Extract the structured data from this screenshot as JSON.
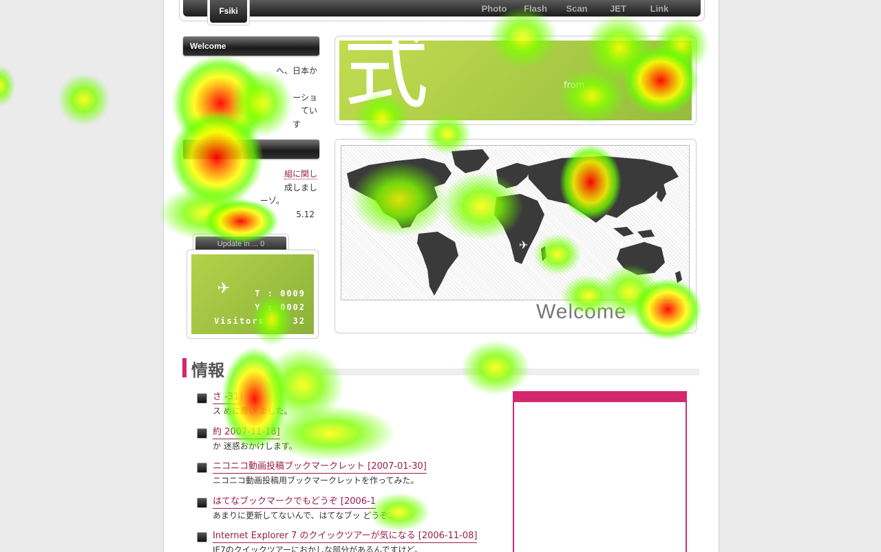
{
  "nav": {
    "brand": "Fsiki",
    "links": [
      "Photo",
      "Flash",
      "Scan",
      "JET",
      "Link"
    ]
  },
  "sidebar": {
    "welcome_title": "Welcome",
    "welcome_lines": [
      "へ、日本か",
      "ーショ",
      "てい",
      "す"
    ],
    "news_lines": [
      "組に関し",
      "成しまし",
      "ーゾ。",
      "5.12"
    ],
    "update_label": "Update in ... 0",
    "visitor_counts": [
      "T : 0009",
      "Y : 0002"
    ],
    "visitors_label": "Visitors",
    "visitors_value": "32"
  },
  "hero": {
    "kanji": "式",
    "from_text": "from"
  },
  "map": {
    "welcome": "Welcome"
  },
  "info": {
    "title": "情報",
    "items": [
      {
        "title": "さ -31]",
        "desc": "ス めに舞い ました。"
      },
      {
        "title": "約 2007-11-18]",
        "desc": "か 迷惑おかけします。"
      },
      {
        "title": "ニコニコ動画投稿ブックマークレット [2007-01-30]",
        "desc": "ニコニコ動画投稿用ブックマークレットを作ってみた。"
      },
      {
        "title": "はてなブックマークでもどうぞ [2006-1",
        "desc": "あまりに更新してないんで、はてなブッ どうぞ..."
      },
      {
        "title": "Internet Explorer 7 のクイックツアーが気になる [2006-11-08]",
        "desc": "IE7のクイックツアーにおかしな部分があるんですけど。"
      }
    ]
  },
  "colors": {
    "accent": "#d2286e",
    "hero_green": "#a6c844",
    "nav_dark": "#1c1c1c"
  }
}
